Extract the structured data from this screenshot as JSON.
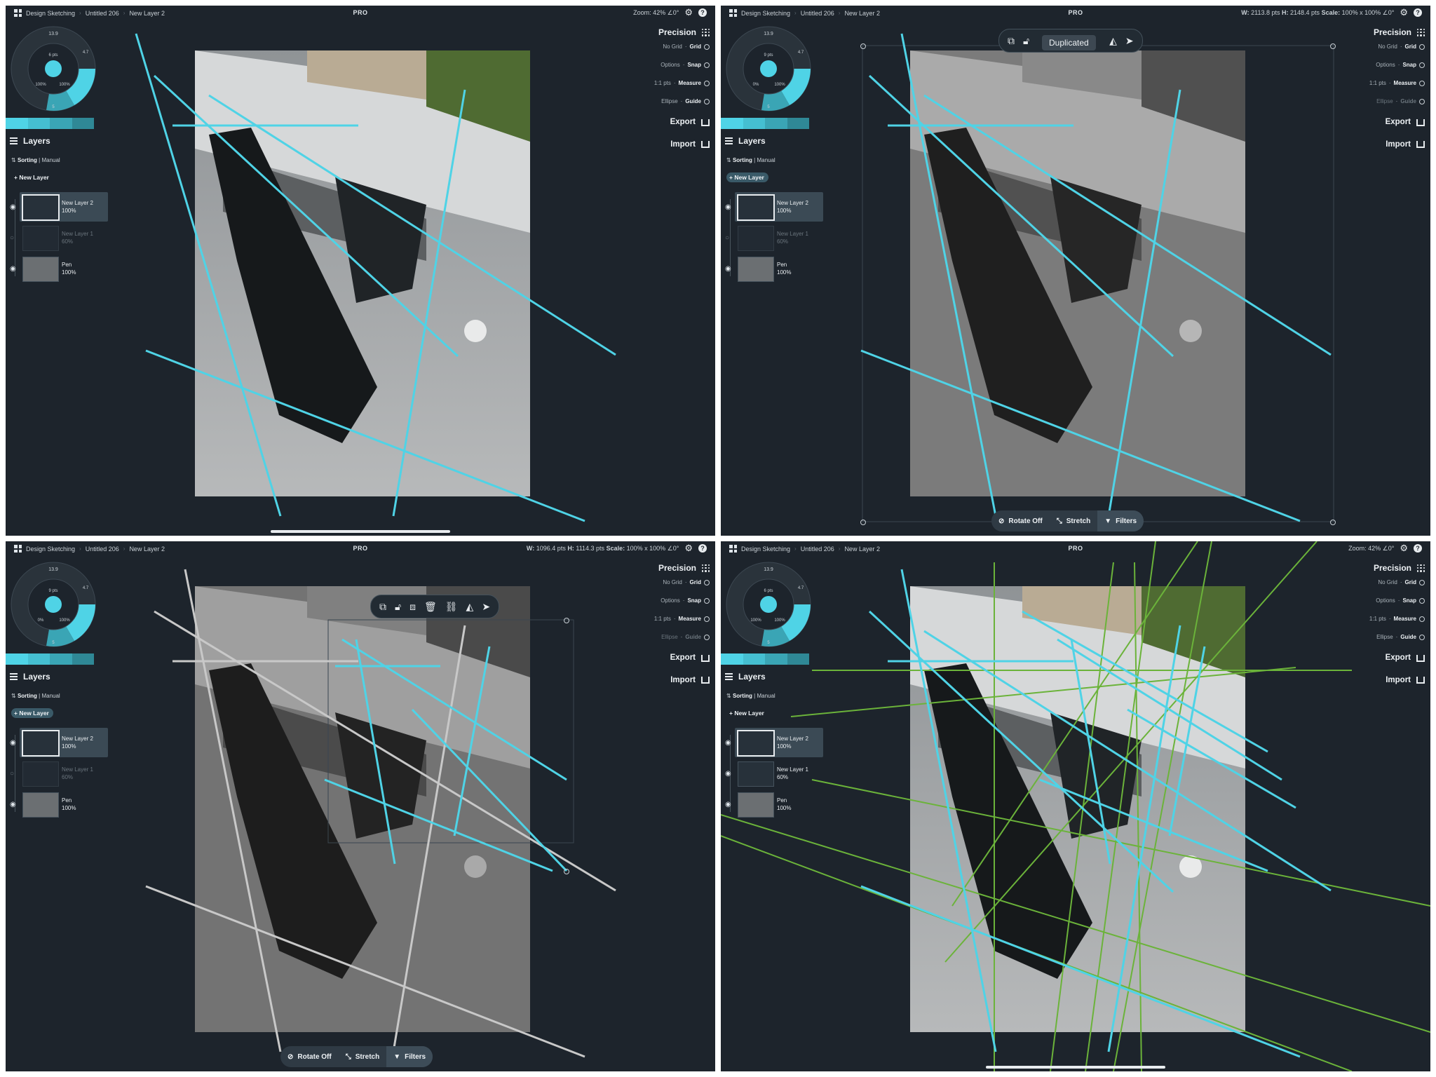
{
  "panels": [
    {
      "breadcrumbs": [
        "Design Sketching",
        "Untitled 206",
        "New Layer 2"
      ],
      "edition": "PRO",
      "status": "Zoom: 42% ∠0°",
      "wheel": {
        "size": "13.9",
        "weight": "6 pts",
        "opacity_a": "100%",
        "opacity_b": "100%",
        "num": "4.7",
        "num_b": "5"
      },
      "layers_title": "Layers",
      "sorting_label": "Sorting",
      "sorting_value": "Manual",
      "new_layer": "New Layer",
      "layers": [
        {
          "name": "New Layer 2",
          "opacity": "100%"
        },
        {
          "name": "New Layer 1",
          "opacity": "60%"
        },
        {
          "name": "Pen",
          "opacity": "100%"
        }
      ],
      "precision": "Precision",
      "options": [
        {
          "left": "No Grid",
          "right": "Grid"
        },
        {
          "left": "Options",
          "right": "Snap"
        },
        {
          "left": "1:1 pts",
          "right": "Measure"
        },
        {
          "left": "Ellipse",
          "right": "Guide"
        }
      ],
      "export": "Export",
      "import": "Import"
    },
    {
      "breadcrumbs": [
        "Design Sketching",
        "Untitled 206",
        "New Layer 2"
      ],
      "edition": "PRO",
      "status_prefix_w": "W:",
      "status_w": "2113.8 pts",
      "status_prefix_h": "H:",
      "status_h": "2148.4 pts",
      "status_prefix_scale": "Scale:",
      "status_scale": "100% x 100% ∠0°",
      "wheel": {
        "size": "13.9",
        "weight": "9 pts",
        "opacity_a": "0%",
        "opacity_b": "100%",
        "num": "4.7",
        "num_b": "5"
      },
      "layers_title": "Layers",
      "sorting_label": "Sorting",
      "sorting_value": "Manual",
      "new_layer": "New Layer",
      "layers": [
        {
          "name": "New Layer 2",
          "opacity": "100%"
        },
        {
          "name": "New Layer 1",
          "opacity": "60%"
        },
        {
          "name": "Pen",
          "opacity": "100%"
        }
      ],
      "precision": "Precision",
      "options": [
        {
          "left": "No Grid",
          "right": "Grid"
        },
        {
          "left": "Options",
          "right": "Snap"
        },
        {
          "left": "1:1 pts",
          "right": "Measure"
        },
        {
          "left": "Ellipse",
          "right": "Guide"
        }
      ],
      "export": "Export",
      "import": "Import",
      "tooltip": "Duplicated",
      "bottom": {
        "rotate": "Rotate Off",
        "stretch": "Stretch",
        "filters": "Filters"
      }
    },
    {
      "breadcrumbs": [
        "Design Sketching",
        "Untitled 206",
        "New Layer 2"
      ],
      "edition": "PRO",
      "status_prefix_w": "W:",
      "status_w": "1096.4 pts",
      "status_prefix_h": "H:",
      "status_h": "1114.3 pts",
      "status_prefix_scale": "Scale:",
      "status_scale": "100% x 100% ∠0°",
      "wheel": {
        "size": "13.9",
        "weight": "9 pts",
        "opacity_a": "0%",
        "opacity_b": "100%",
        "num": "4.7",
        "num_b": "5"
      },
      "layers_title": "Layers",
      "sorting_label": "Sorting",
      "sorting_value": "Manual",
      "new_layer": "New Layer",
      "layers": [
        {
          "name": "New Layer 2",
          "opacity": "100%"
        },
        {
          "name": "New Layer 1",
          "opacity": "60%"
        },
        {
          "name": "Pen",
          "opacity": "100%"
        }
      ],
      "precision": "Precision",
      "options": [
        {
          "left": "No Grid",
          "right": "Grid"
        },
        {
          "left": "Options",
          "right": "Snap"
        },
        {
          "left": "1:1 pts",
          "right": "Measure"
        },
        {
          "left": "Ellipse",
          "right": "Guide"
        }
      ],
      "export": "Export",
      "import": "Import",
      "bottom": {
        "rotate": "Rotate Off",
        "stretch": "Stretch",
        "filters": "Filters"
      }
    },
    {
      "breadcrumbs": [
        "Design Sketching",
        "Untitled 206",
        "New Layer 2"
      ],
      "edition": "PRO",
      "status": "Zoom: 42% ∠0°",
      "wheel": {
        "size": "13.9",
        "weight": "6 pts",
        "opacity_a": "100%",
        "opacity_b": "100%",
        "num": "4.7",
        "num_b": "5"
      },
      "layers_title": "Layers",
      "sorting_label": "Sorting",
      "sorting_value": "Manual",
      "new_layer": "New Layer",
      "layers": [
        {
          "name": "New Layer 2",
          "opacity": "100%"
        },
        {
          "name": "New Layer 1",
          "opacity": "60%"
        },
        {
          "name": "Pen",
          "opacity": "100%"
        }
      ],
      "precision": "Precision",
      "options": [
        {
          "left": "No Grid",
          "right": "Grid"
        },
        {
          "left": "Options",
          "right": "Snap"
        },
        {
          "left": "1:1 pts",
          "right": "Measure"
        },
        {
          "left": "Ellipse",
          "right": "Guide"
        }
      ],
      "export": "Export",
      "import": "Import"
    }
  ],
  "colors": {
    "panel_bg": "#1d242c",
    "cyan": "#4fd3e6",
    "green": "#6bb33a",
    "swatch": [
      "#4fd3e6",
      "#45bfd1",
      "#3aa5b5",
      "#2f8896"
    ]
  },
  "icons": [
    "apps-grid-icon",
    "gear-icon",
    "help-icon",
    "precision-grid-icon",
    "export-icon",
    "import-icon",
    "eye-icon",
    "hamburger-icon",
    "sort-icon",
    "plus-icon",
    "copy-icon",
    "lock-icon",
    "duplicate-icon",
    "trash-icon",
    "link-icon",
    "flip-icon",
    "send-icon",
    "rotate-off-icon",
    "stretch-icon",
    "filter-icon"
  ]
}
